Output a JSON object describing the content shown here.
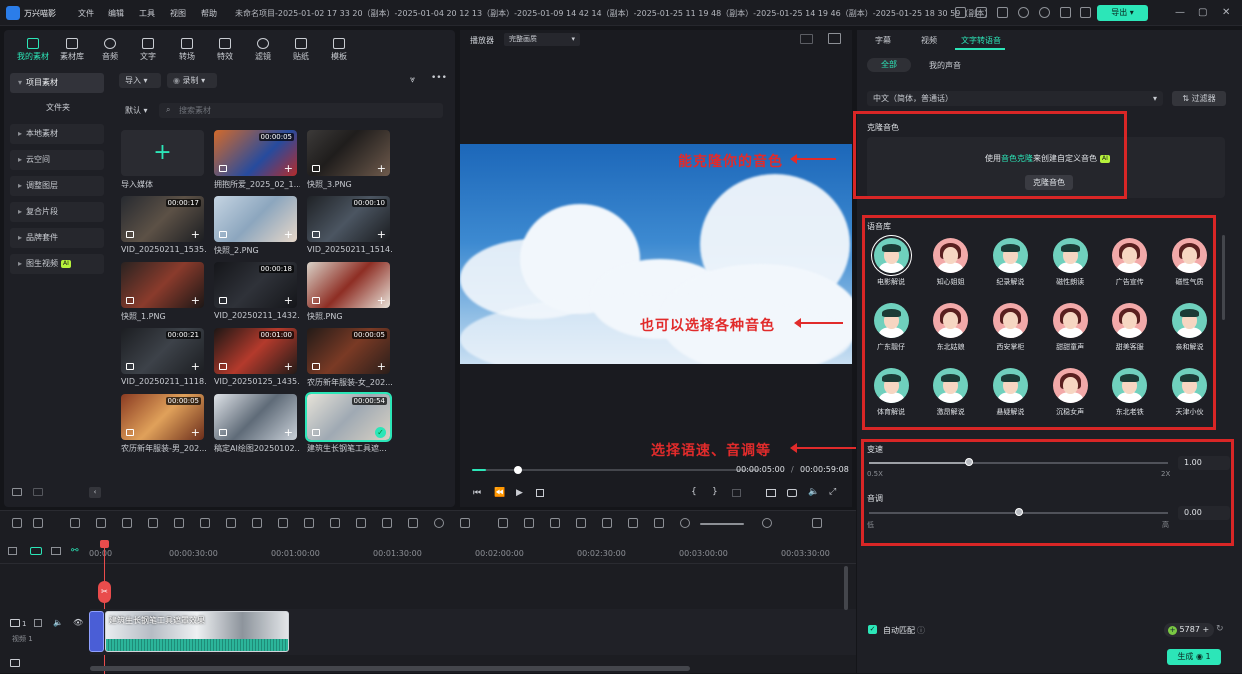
{
  "app": {
    "name": "万兴喵影",
    "menus": [
      "文件",
      "编辑",
      "工具",
      "视图",
      "帮助"
    ],
    "project_title": "未命名项目-2025-01-02 17 33 20（副本）-2025-01-04 20 12 13（副本）-2025-01-09 14 42 14（副本）-2025-01-25 11 19 48（副本）-2025-01-25 14 19 46（副本）-2025-01-25 18 30 59（副本）",
    "export_label": "导出",
    "window_controls": [
      "—",
      "▢",
      "✕"
    ]
  },
  "media_tabs": [
    "我的素材",
    "素材库",
    "音频",
    "文字",
    "转场",
    "特效",
    "滤镜",
    "贴纸",
    "模板"
  ],
  "sidebar": {
    "items": [
      {
        "label": "项目素材",
        "caret": "▾"
      },
      {
        "label": "文件夹",
        "caret": ""
      },
      {
        "label": "本地素材",
        "caret": "▸"
      },
      {
        "label": "云空间",
        "caret": "▸"
      },
      {
        "label": "调整图层",
        "caret": "▸"
      },
      {
        "label": "复合片段",
        "caret": "▸"
      },
      {
        "label": "品牌套件",
        "caret": "▸"
      },
      {
        "label": "图生视频",
        "caret": "▸",
        "badge": "AI"
      }
    ]
  },
  "media_toolbar": {
    "import_label": "导入",
    "record_label": "录制",
    "sort_label": "默认",
    "search_placeholder": "搜索素材"
  },
  "media_items": [
    {
      "name": "导入媒体",
      "duration": "",
      "kind": "import"
    },
    {
      "name": "拥抱所爱_2025_02_1...",
      "duration": "00:00:05",
      "kind": "video"
    },
    {
      "name": "快照_3.PNG",
      "duration": "",
      "kind": "image"
    },
    {
      "name": "VID_20250211_1535...",
      "duration": "00:00:17",
      "kind": "video"
    },
    {
      "name": "快照_2.PNG",
      "duration": "",
      "kind": "image"
    },
    {
      "name": "VID_20250211_1514...",
      "duration": "00:00:10",
      "kind": "video"
    },
    {
      "name": "快照_1.PNG",
      "duration": "",
      "kind": "image"
    },
    {
      "name": "VID_20250211_1432...",
      "duration": "00:00:18",
      "kind": "video"
    },
    {
      "name": "快照.PNG",
      "duration": "",
      "kind": "image"
    },
    {
      "name": "VID_20250211_1118...",
      "duration": "00:00:21",
      "kind": "video"
    },
    {
      "name": "VID_20250125_1435...",
      "duration": "00:01:00",
      "kind": "video"
    },
    {
      "name": "农历新年服装-女_202...",
      "duration": "00:00:05",
      "kind": "video"
    },
    {
      "name": "农历新年服装-男_202...",
      "duration": "00:00:05",
      "kind": "video"
    },
    {
      "name": "稿定AI绘图20250102...",
      "duration": "",
      "kind": "image"
    },
    {
      "name": "建筑生长钢笔工具遮...",
      "duration": "00:00:54",
      "kind": "video-selected"
    }
  ],
  "player": {
    "label": "播放器",
    "quality": "完整画质",
    "current_time": "00:00:05:00",
    "total_time": "00:00:59:08",
    "progress": 0.05
  },
  "annotations": {
    "clone_note": "能克隆你的音色",
    "voices_note": "也可以选择各种音色",
    "speed_note": "选择语速、音调等"
  },
  "timeline": {
    "ruler": [
      "00:00",
      "00:00:30:00",
      "00:01:00:00",
      "00:01:30:00",
      "00:02:00:00",
      "00:02:30:00",
      "00:03:00:00",
      "00:03:30:00"
    ],
    "track_label": "视频 1",
    "track_number": "1",
    "clip_title": "建筑生长钢笔工具遮罩效果"
  },
  "right_panel": {
    "tabs": [
      "字幕",
      "视频",
      "文字转语音"
    ],
    "sub_tabs": [
      "全部",
      "我的声音"
    ],
    "language": "中文（简体，普通话）",
    "filter_label": "过滤器",
    "clone": {
      "title": "克隆音色",
      "desc_prefix": "使用",
      "desc_link": "音色克隆",
      "desc_suffix": "来创建自定义音色",
      "badge": "AI",
      "button": "克隆音色"
    },
    "library_title": "语音库",
    "voices": [
      {
        "name": "电影解说",
        "gender": "m"
      },
      {
        "name": "知心姐姐",
        "gender": "f"
      },
      {
        "name": "纪录解说",
        "gender": "m"
      },
      {
        "name": "磁性朗读",
        "gender": "m"
      },
      {
        "name": "广告宣传",
        "gender": "f"
      },
      {
        "name": "磁性气质",
        "gender": "f"
      },
      {
        "name": "广东靓仔",
        "gender": "m"
      },
      {
        "name": "东北姑娘",
        "gender": "f"
      },
      {
        "name": "西安掌柜",
        "gender": "f"
      },
      {
        "name": "甜甜童声",
        "gender": "f"
      },
      {
        "name": "甜美客服",
        "gender": "f"
      },
      {
        "name": "亲和解说",
        "gender": "m"
      },
      {
        "name": "体育解说",
        "gender": "m"
      },
      {
        "name": "激昂解说",
        "gender": "m"
      },
      {
        "name": "悬疑解说",
        "gender": "m"
      },
      {
        "name": "沉稳女声",
        "gender": "f"
      },
      {
        "name": "东北老铁",
        "gender": "m"
      },
      {
        "name": "天津小伙",
        "gender": "m"
      }
    ],
    "speed": {
      "label": "变速",
      "min": "0.5X",
      "max": "2X",
      "value": "1.00",
      "level": 0.333
    },
    "pitch": {
      "label": "音调",
      "min": "低",
      "max": "高",
      "value": "0.00",
      "level": 0.5
    },
    "auto_match_label": "自动匹配",
    "credits": "5787",
    "generate_label": "生成",
    "generate_cost": "1"
  },
  "colors": {
    "accent": "#2ce6b8",
    "annotation": "#e12b2b",
    "male_avatar": "#6fd0bd",
    "female_avatar": "#f2a9a9"
  }
}
